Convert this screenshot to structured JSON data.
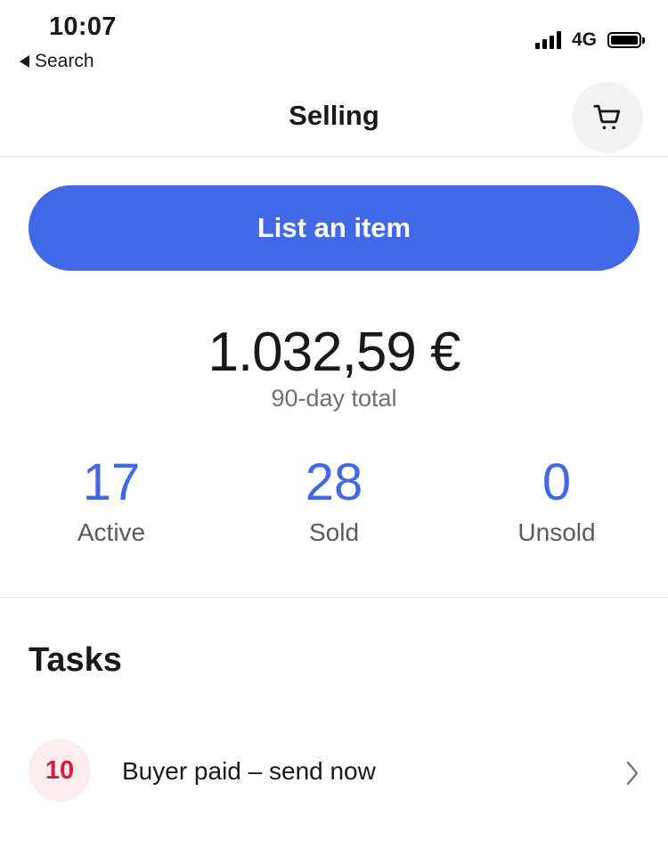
{
  "status_bar": {
    "time": "10:07",
    "back_label": "Search",
    "network": "4G",
    "signal_icon": "signal-bars-icon",
    "battery_icon": "battery-full-icon"
  },
  "header": {
    "title": "Selling",
    "cart_icon": "shopping-cart-icon"
  },
  "primary_action": {
    "label": "List an item",
    "color": "#4168e6"
  },
  "summary": {
    "total": "1.032,59 €",
    "total_label": "90-day total"
  },
  "stats": [
    {
      "value": "17",
      "label": "Active"
    },
    {
      "value": "28",
      "label": "Sold"
    },
    {
      "value": "0",
      "label": "Unsold"
    }
  ],
  "tasks": {
    "title": "Tasks",
    "items": [
      {
        "count": "10",
        "label": "Buyer paid – send now",
        "icon": "chevron-right-icon"
      }
    ]
  },
  "colors": {
    "accent": "#4168e6",
    "badge_text": "#d11f3a",
    "badge_bg": "#fdecef"
  }
}
